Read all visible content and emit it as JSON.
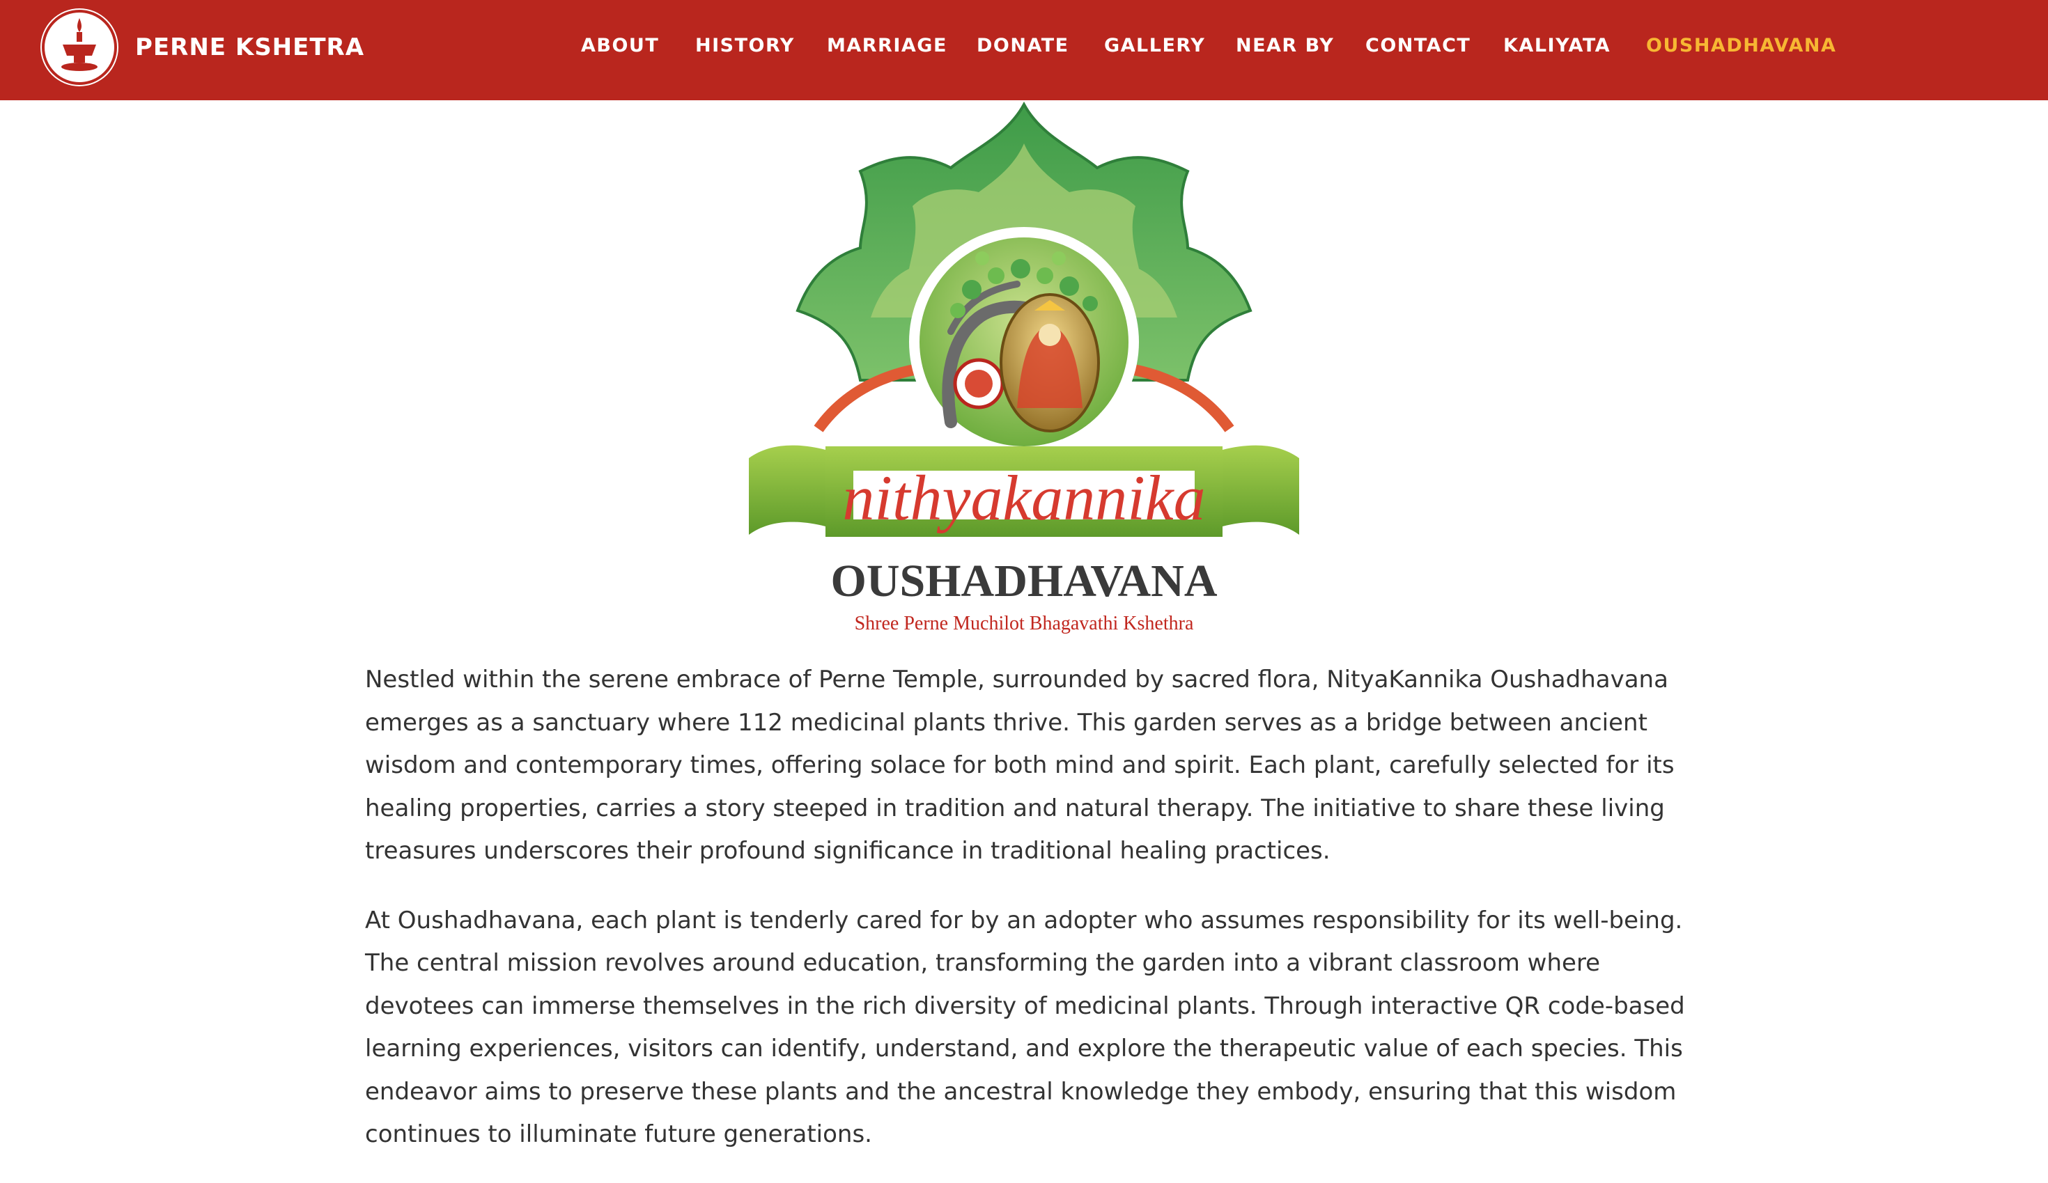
{
  "brand": {
    "name": "PERNE KSHETRA",
    "logo_icon": "temple-lamp-icon"
  },
  "nav": {
    "items": [
      {
        "label": "ABOUT"
      },
      {
        "label": "HISTORY"
      },
      {
        "label": "MARRIAGE"
      },
      {
        "label": "DONATE"
      },
      {
        "label": "GALLERY"
      },
      {
        "label": "NEAR BY"
      },
      {
        "label": "CONTACT"
      },
      {
        "label": "KALIYATA"
      },
      {
        "label": "OUSHADHAVANA",
        "active": true
      }
    ]
  },
  "hero": {
    "script_title": "nithyakannika",
    "title": "OUSHADHAVANA",
    "subtitle": "Shree Perne Muchilot Bhagavathi Kshethra"
  },
  "content": {
    "paragraphs": [
      "Nestled within the serene embrace of Perne Temple, surrounded by sacred flora, NityaKannika Oushadhavana emerges as a sanctuary where 112 medicinal plants thrive. This garden serves as a bridge between ancient wisdom and contemporary times, offering solace for both mind and spirit. Each plant, carefully selected for its healing properties, carries a story steeped in tradition and natural therapy. The initiative to share these living treasures underscores their profound significance in traditional healing practices.",
      "At Oushadhavana, each plant is tenderly cared for by an adopter who assumes responsibility for its well-being. The central mission revolves around education, transforming the garden into a vibrant classroom where devotees can immerse themselves in the rich diversity of medicinal plants. Through interactive QR code-based learning experiences, visitors can identify, understand, and explore the therapeutic value of each species. This endeavor aims to preserve these plants and the ancestral knowledge they embody, ensuring that this wisdom continues to illuminate future generations."
    ]
  },
  "colors": {
    "header_bg": "#b9261e",
    "nav_active": "#f7b733",
    "leaf_green": "#4fa64a",
    "ribbon_green": "#86b83a",
    "script_red": "#d63a2f",
    "title_dark": "#3a3a3a"
  }
}
